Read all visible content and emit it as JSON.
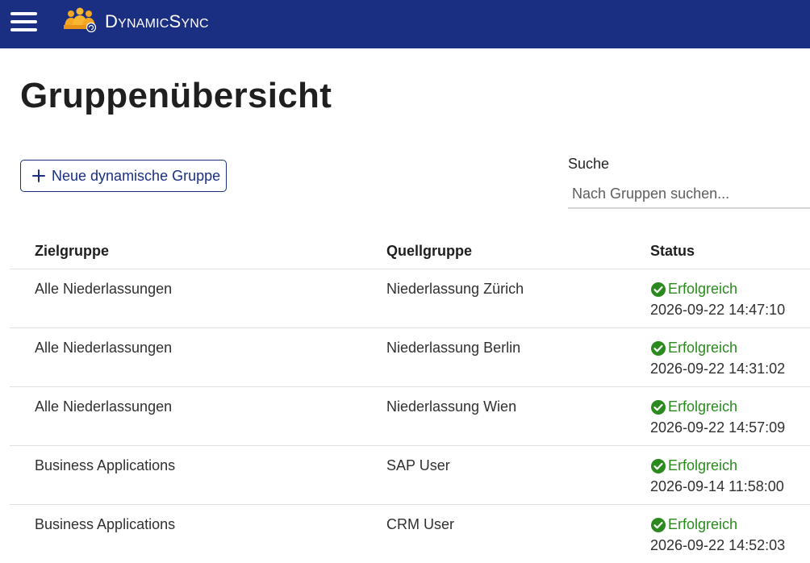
{
  "app": {
    "brand_prefix": "D",
    "brand_rest_1": "YNAMIC",
    "brand_s": "S",
    "brand_rest_2": "YNC",
    "brand_full": "DynamicSync"
  },
  "page": {
    "title": "Gruppenübersicht"
  },
  "toolbar": {
    "new_group_label": "Neue dynamische Gruppe",
    "search_label": "Suche",
    "search_placeholder": "Nach Gruppen suchen...",
    "search_value": ""
  },
  "table": {
    "headers": [
      "Zielgruppe",
      "Quellgruppe",
      "Status"
    ],
    "rows": [
      {
        "target": "Alle Niederlassungen",
        "source": "Niederlassung Zürich",
        "status": "Erfolgreich",
        "timestamp": "2026-09-22 14:47:10"
      },
      {
        "target": "Alle Niederlassungen",
        "source": "Niederlassung Berlin",
        "status": "Erfolgreich",
        "timestamp": "2026-09-22 14:31:02"
      },
      {
        "target": "Alle Niederlassungen",
        "source": "Niederlassung Wien",
        "status": "Erfolgreich",
        "timestamp": "2026-09-22 14:57:09"
      },
      {
        "target": "Business Applications",
        "source": "SAP User",
        "status": "Erfolgreich",
        "timestamp": "2026-09-14 11:58:00"
      },
      {
        "target": "Business Applications",
        "source": "CRM User",
        "status": "Erfolgreich",
        "timestamp": "2026-09-22 14:52:03"
      }
    ]
  },
  "colors": {
    "header_bg": "#1b2f82",
    "accent": "#1b2f82",
    "success": "#2a8a1e",
    "logo": "#f5a623"
  },
  "icons": {
    "menu": "hamburger-menu-icon",
    "logo": "people-sync-logo-icon",
    "add": "plus-icon",
    "status": "check-circle-icon"
  }
}
